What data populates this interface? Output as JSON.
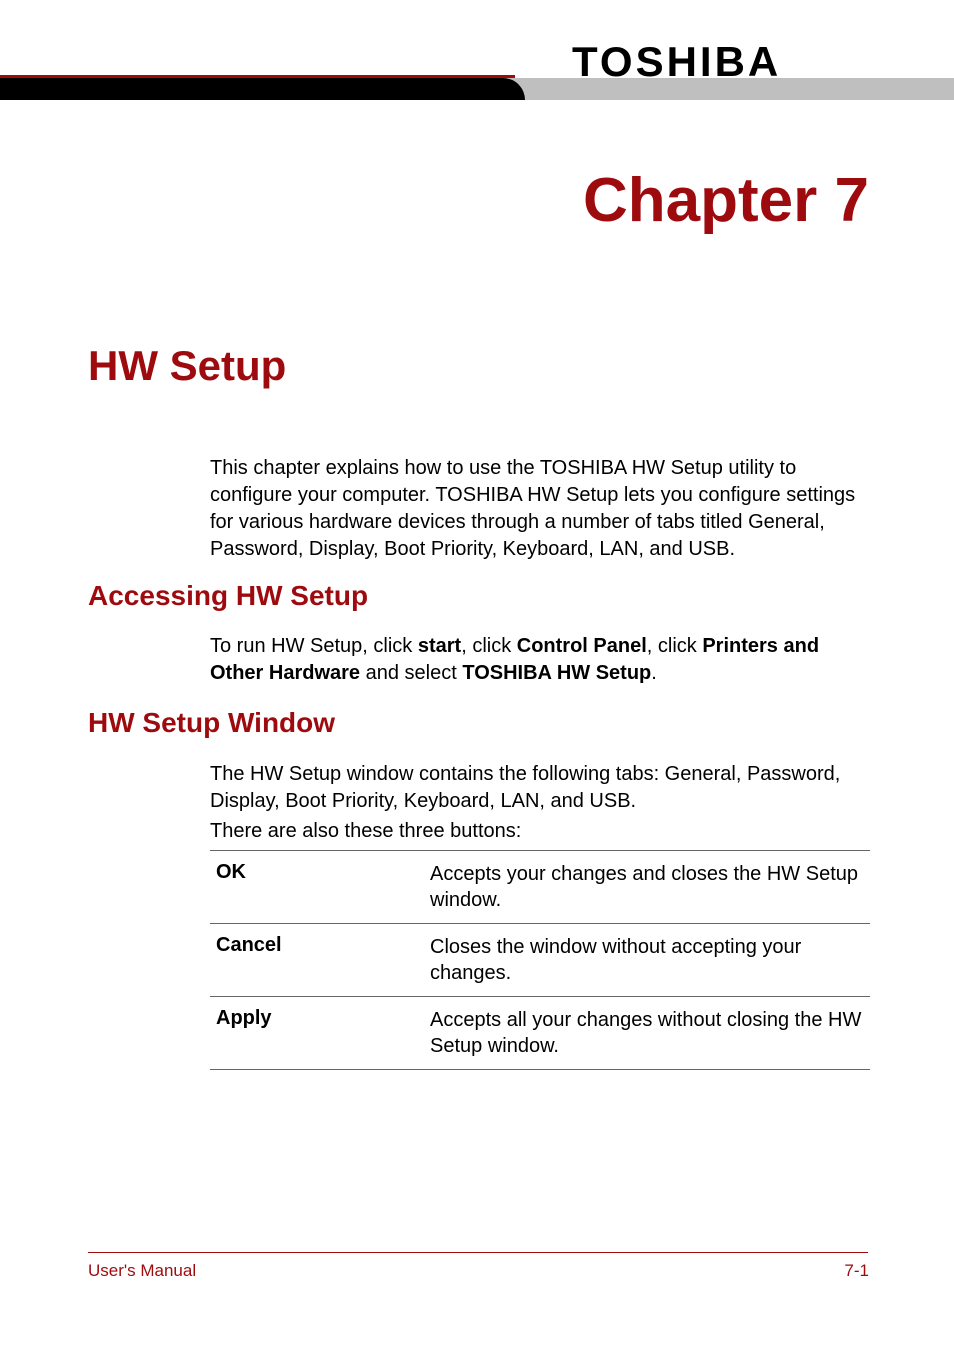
{
  "brand": "TOSHIBA",
  "chapter": {
    "title": "Chapter 7"
  },
  "section": {
    "title": "HW Setup",
    "intro": "This chapter explains how to use the TOSHIBA HW Setup utility to configure your computer. TOSHIBA HW Setup lets you configure settings for various hardware devices through a number of tabs titled General, Password, Display, Boot Priority, Keyboard, LAN, and USB."
  },
  "accessing": {
    "heading": "Accessing HW Setup",
    "text_prefix": "To run HW Setup, click ",
    "start": "start",
    "text_mid1": ", click ",
    "control_panel": "Control Panel",
    "text_mid2": ", click ",
    "printers": "Printers and Other Hardware",
    "text_mid3": " and select ",
    "hw_setup": "TOSHIBA HW Setup",
    "text_suffix": "."
  },
  "window": {
    "heading": "HW Setup Window",
    "para1": "The HW Setup window contains the following tabs: General, Password, Display, Boot Priority, Keyboard, LAN, and USB.",
    "para2": "There are also these three buttons:"
  },
  "buttons": {
    "ok_label": "OK",
    "ok_desc": "Accepts your changes and closes the HW Setup window.",
    "cancel_label": "Cancel",
    "cancel_desc": "Closes the window without accepting your changes.",
    "apply_label": "Apply",
    "apply_desc": "Accepts all your changes without closing the HW Setup window."
  },
  "footer": {
    "left": "User's Manual",
    "right": "7-1"
  }
}
